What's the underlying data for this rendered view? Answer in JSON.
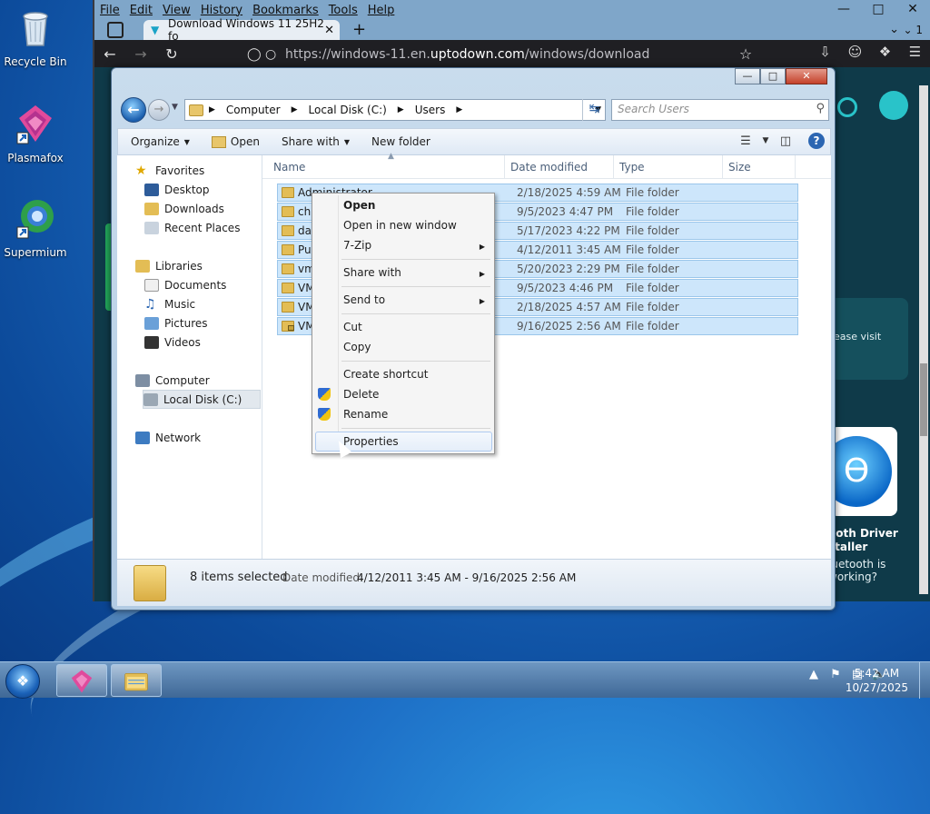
{
  "desktop": {
    "icons": [
      {
        "label": "Recycle Bin",
        "icon": "recycle-bin-icon"
      },
      {
        "label": "Plasmafox",
        "icon": "plasmafox-icon"
      },
      {
        "label": "Supermium",
        "icon": "supermium-icon"
      }
    ]
  },
  "browser": {
    "menu": [
      "File",
      "Edit",
      "View",
      "History",
      "Bookmarks",
      "Tools",
      "Help"
    ],
    "tab_title": "Download Windows 11 25H2 fo",
    "tab_count": "1",
    "url_prefix": "https://windows-11.en.",
    "url_domain": "uptodown.com",
    "url_path": "/windows/download",
    "site": {
      "card_text": "ease visit",
      "app_title": "ooth Driver staller",
      "app_question": "luetooth is working?"
    }
  },
  "explorer": {
    "breadcrumb": [
      "Computer",
      "Local Disk (C:)",
      "Users"
    ],
    "search_placeholder": "Search Users",
    "commands": {
      "organize": "Organize",
      "open": "Open",
      "share_with": "Share with",
      "new_folder": "New folder"
    },
    "nav": {
      "favorites": "Favorites",
      "desktop": "Desktop",
      "downloads": "Downloads",
      "recent": "Recent Places",
      "libraries": "Libraries",
      "documents": "Documents",
      "music": "Music",
      "pictures": "Pictures",
      "videos": "Videos",
      "computer": "Computer",
      "local_disk": "Local Disk (C:)",
      "network": "Network"
    },
    "columns": [
      "Name",
      "Date modified",
      "Type",
      "Size"
    ],
    "rows": [
      {
        "name": "Administrator",
        "date": "2/18/2025 4:59 AM",
        "type": "File folder"
      },
      {
        "name": "ch",
        "date": "9/5/2023 4:47 PM",
        "type": "File folder"
      },
      {
        "name": "da",
        "date": "5/17/2023 4:22 PM",
        "type": "File folder"
      },
      {
        "name": "Pu",
        "date": "4/12/2011 3:45 AM",
        "type": "File folder"
      },
      {
        "name": "vm",
        "date": "5/20/2023 2:29 PM",
        "type": "File folder"
      },
      {
        "name": "VM",
        "date": "9/5/2023 4:46 PM",
        "type": "File folder"
      },
      {
        "name": "VM",
        "date": "2/18/2025 4:57 AM",
        "type": "File folder"
      },
      {
        "name": "VM",
        "date": "9/16/2025 2:56 AM",
        "type": "File folder"
      }
    ],
    "status": {
      "count": "8 items selected",
      "date_label": "Date modified:",
      "date_range": "4/12/2011 3:45 AM - 9/16/2025 2:56 AM"
    }
  },
  "context_menu": {
    "open": "Open",
    "open_new_window": "Open in new window",
    "seven_zip": "7-Zip",
    "share_with": "Share with",
    "send_to": "Send to",
    "cut": "Cut",
    "copy": "Copy",
    "create_shortcut": "Create shortcut",
    "delete": "Delete",
    "rename": "Rename",
    "properties": "Properties"
  },
  "taskbar": {
    "time": "5:42 AM",
    "date": "10/27/2025"
  }
}
